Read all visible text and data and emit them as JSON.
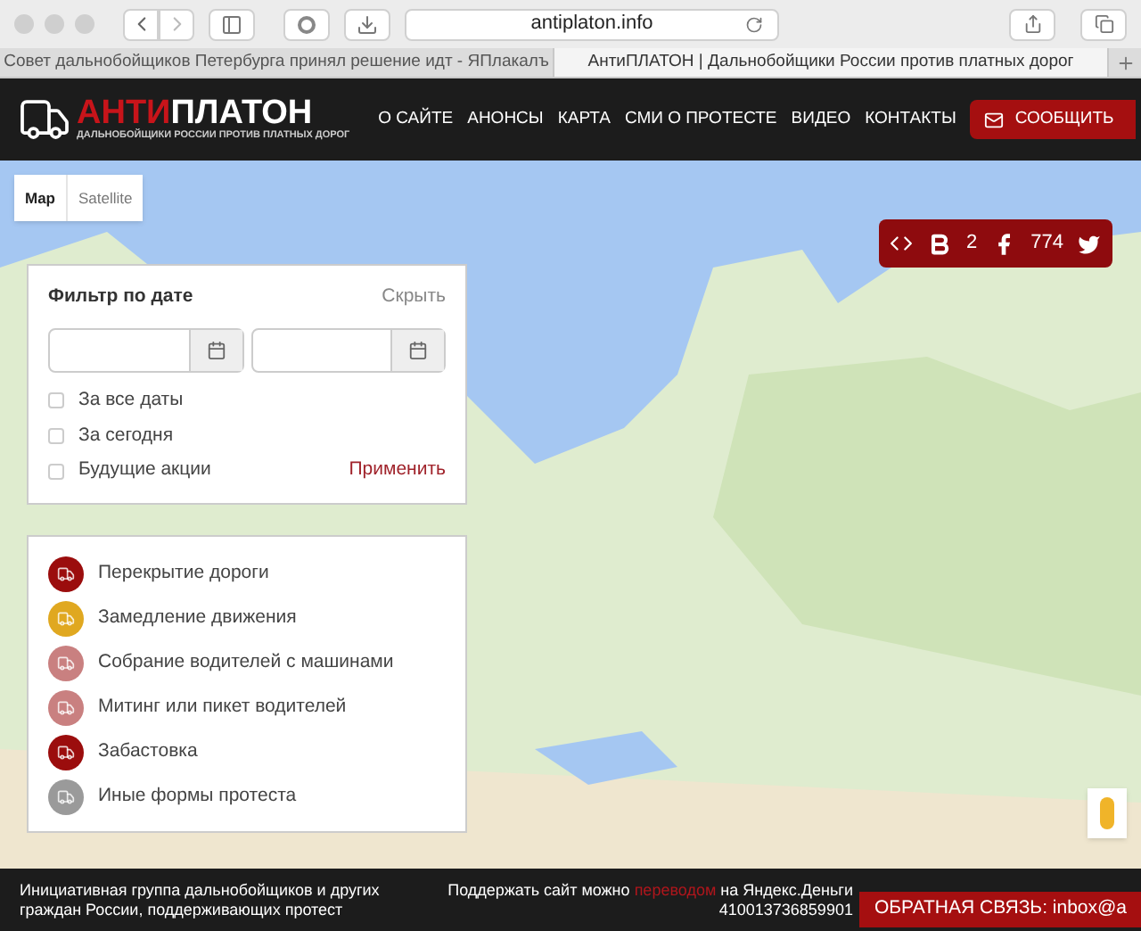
{
  "browser": {
    "address": "antiplaton.info",
    "tabs": [
      {
        "label": "Совет дальнобойщиков Петербурга принял решение идт - ЯПлакалъ",
        "selected": false
      },
      {
        "label": "АнтиПЛАТОН | Дальнобойщики России против платных дорог",
        "selected": true
      }
    ]
  },
  "header": {
    "logo_accent": "АНТИ",
    "logo_main": "ПЛАТОН",
    "tagline": "ДАЛЬНОБОЙЩИКИ РОССИИ ПРОТИВ ПЛАТНЫХ ДОРОГ",
    "nav": [
      "О САЙТЕ",
      "АНОНСЫ",
      "КАРТА",
      "СМИ О ПРОТЕСТЕ",
      "ВИДЕО",
      "КОНТАКТЫ"
    ],
    "report_button": "СООБЩИТЬ"
  },
  "map_types": [
    {
      "label": "Map",
      "selected": true
    },
    {
      "label": "Satellite",
      "selected": false
    }
  ],
  "share": {
    "blogger_count": "2",
    "facebook_count": "774"
  },
  "filter": {
    "title": "Фильтр по дате",
    "hide_link": "Скрыть",
    "apply_link": "Применить",
    "options": [
      {
        "label": "За все даты",
        "checked": false
      },
      {
        "label": "За сегодня",
        "checked": false
      },
      {
        "label": "Будущие акции",
        "checked": false
      }
    ]
  },
  "legend": [
    {
      "label": "Перекрытие дороги",
      "color": "#9b0d0d"
    },
    {
      "label": "Замедление движения",
      "color": "#e0a820"
    },
    {
      "label": "Собрание водителей с машинами",
      "color": "#c98080"
    },
    {
      "label": "Митинг или пикет водителей",
      "color": "#c98080"
    },
    {
      "label": "Забастовка",
      "color": "#9b0d0d"
    },
    {
      "label": "Иные формы протеста",
      "color": "#9a9a9a"
    }
  ],
  "footer": {
    "about": "Инициативная группа дальнобойщиков и других граждан России, поддерживающих протест",
    "support_before": "Поддержать сайт можно",
    "support_link": "переводом",
    "support_after": "на Яндекс.Деньги",
    "wallet": "410013736859901",
    "feedback": "ОБРАТНАЯ СВЯЗЬ: inbox@a"
  }
}
